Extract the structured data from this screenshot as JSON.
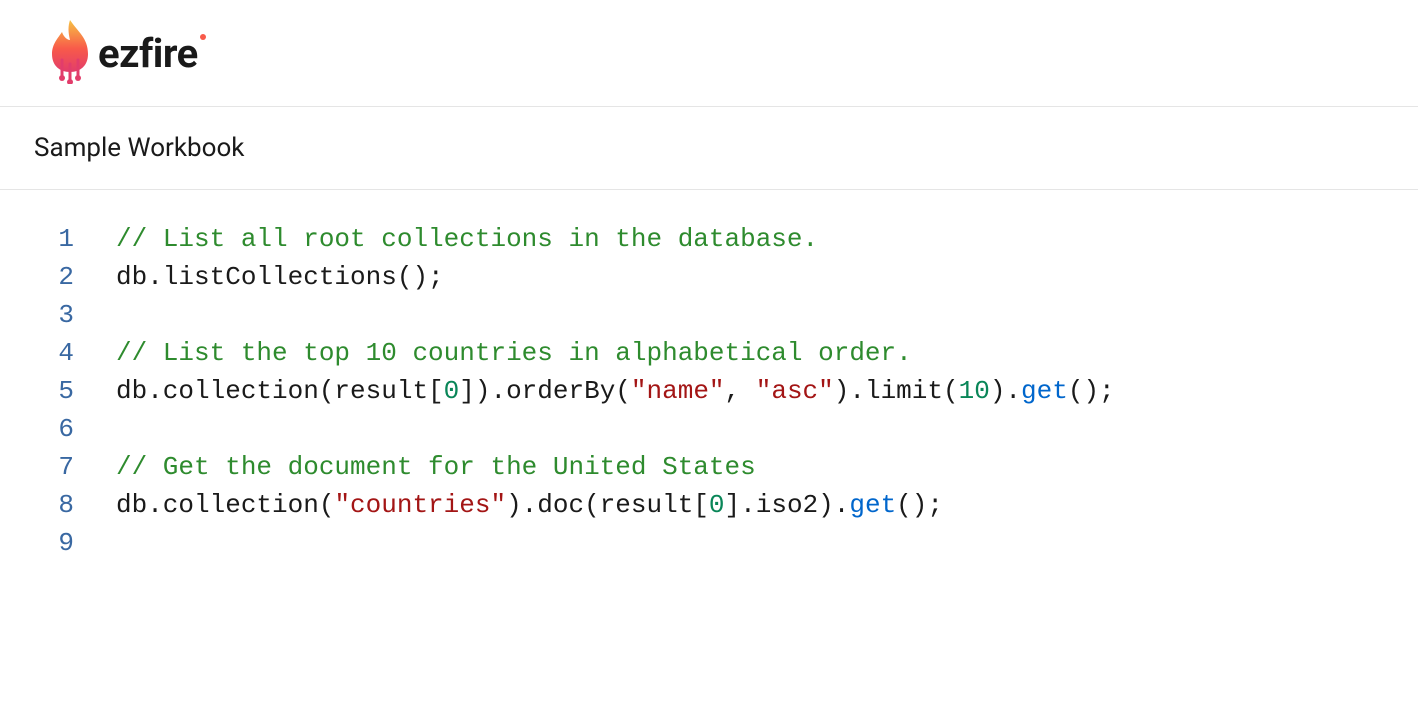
{
  "brand": {
    "name": "ezfire"
  },
  "page": {
    "title": "Sample Workbook"
  },
  "editor": {
    "lineCount": 9,
    "lines": [
      [
        {
          "cls": "tok-comment",
          "t": "// List all root collections in the database."
        }
      ],
      [
        {
          "cls": "tok-default",
          "t": "db.listCollections();"
        }
      ],
      [
        {
          "cls": "tok-default",
          "t": ""
        }
      ],
      [
        {
          "cls": "tok-comment",
          "t": "// List the top 10 countries in alphabetical order."
        }
      ],
      [
        {
          "cls": "tok-default",
          "t": "db.collection(result["
        },
        {
          "cls": "tok-number",
          "t": "0"
        },
        {
          "cls": "tok-default",
          "t": "]).orderBy("
        },
        {
          "cls": "tok-string",
          "t": "\"name\""
        },
        {
          "cls": "tok-default",
          "t": ", "
        },
        {
          "cls": "tok-string",
          "t": "\"asc\""
        },
        {
          "cls": "tok-default",
          "t": ").limit("
        },
        {
          "cls": "tok-number",
          "t": "10"
        },
        {
          "cls": "tok-default",
          "t": ")."
        },
        {
          "cls": "tok-method",
          "t": "get"
        },
        {
          "cls": "tok-default",
          "t": "();"
        }
      ],
      [
        {
          "cls": "tok-default",
          "t": ""
        }
      ],
      [
        {
          "cls": "tok-comment",
          "t": "// Get the document for the United States"
        }
      ],
      [
        {
          "cls": "tok-default",
          "t": "db.collection("
        },
        {
          "cls": "tok-string",
          "t": "\"countries\""
        },
        {
          "cls": "tok-default",
          "t": ").doc(result["
        },
        {
          "cls": "tok-number",
          "t": "0"
        },
        {
          "cls": "tok-default",
          "t": "].iso2)."
        },
        {
          "cls": "tok-method",
          "t": "get"
        },
        {
          "cls": "tok-default",
          "t": "();"
        }
      ],
      [
        {
          "cls": "tok-default",
          "t": ""
        }
      ]
    ]
  }
}
